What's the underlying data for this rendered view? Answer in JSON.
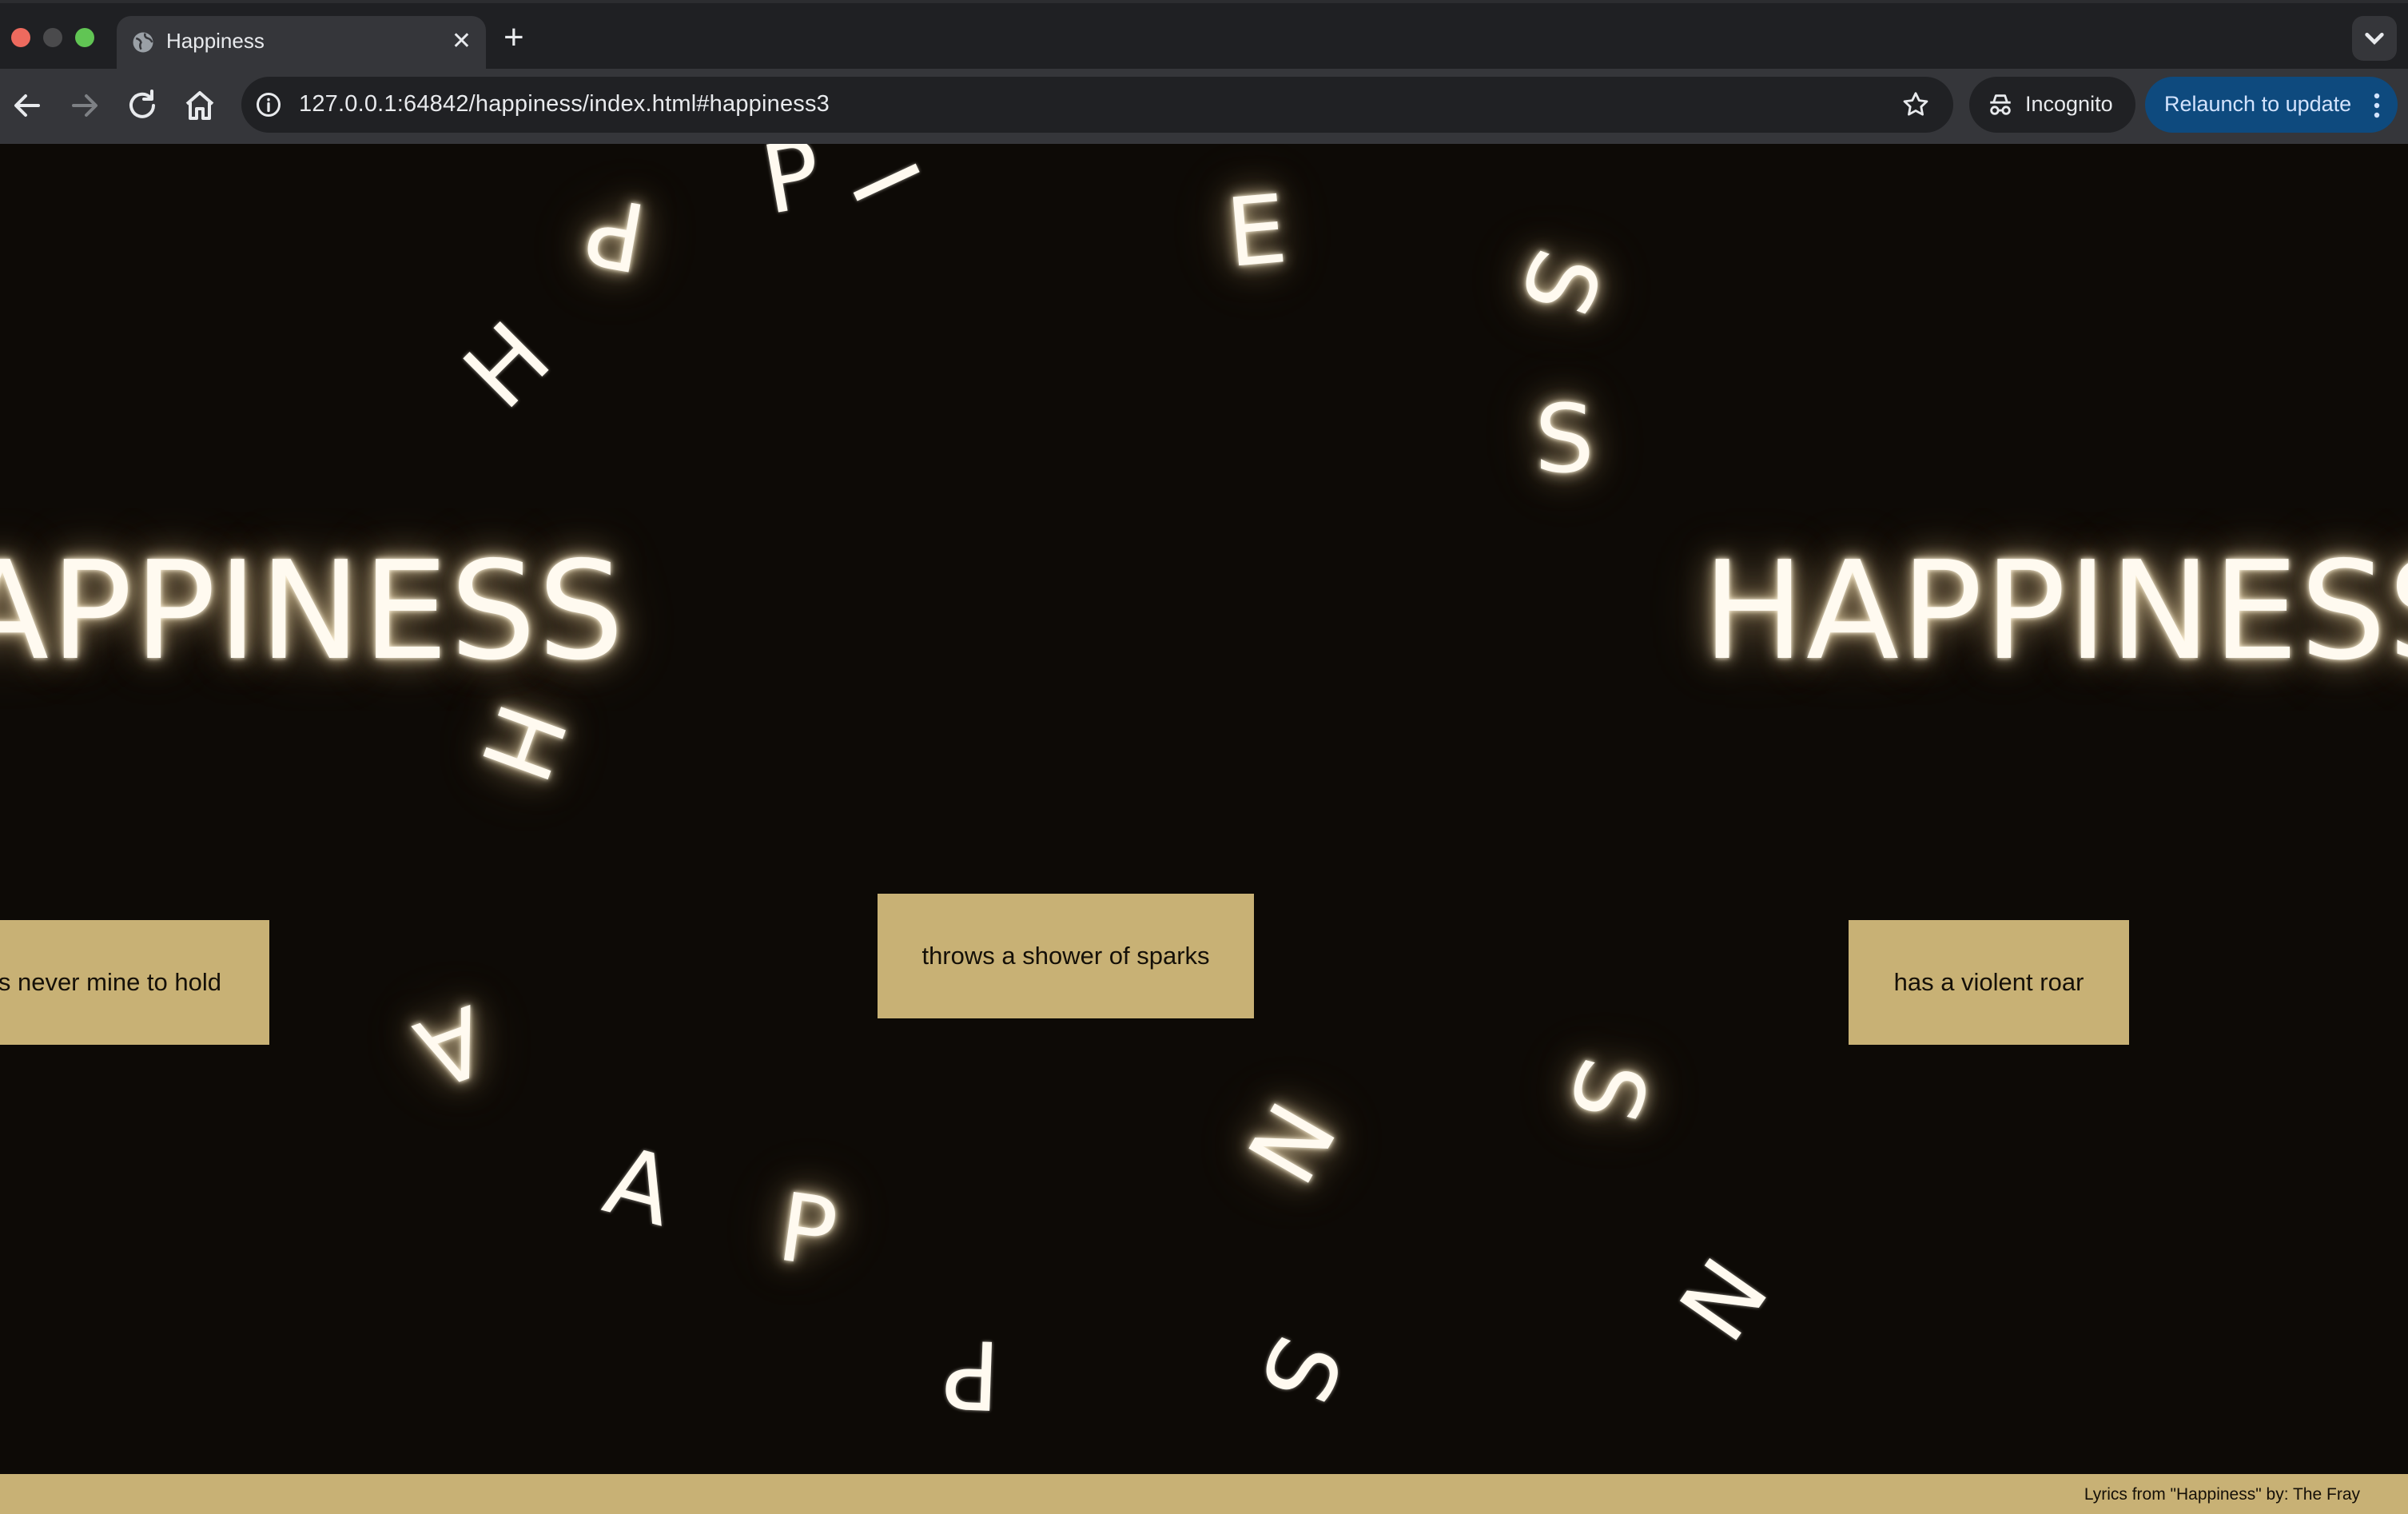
{
  "browser": {
    "tab_title": "Happiness",
    "tab_close": "✕",
    "new_tab": "+",
    "url": "127.0.0.1:64842/happiness/index.html#happiness3",
    "incognito_label": "Incognito",
    "relaunch_label": "Relaunch to update"
  },
  "page": {
    "words": [
      "HAPPINESS",
      "HAPPINESS"
    ],
    "letters": [
      "P",
      "P",
      "I",
      "E",
      "H",
      "S",
      "S",
      "H",
      "A",
      "A",
      "P",
      "N",
      "S",
      "P",
      "S",
      "N"
    ],
    "lyrics": [
      "was never mine to hold",
      "throws a shower of sparks",
      "has a violent roar"
    ],
    "footer": "Lyrics from \"Happiness\" by: The Fray"
  },
  "colors": {
    "background": "#0d0a06",
    "lyric_box": "#c8b175",
    "glow": "#fffaf0",
    "relaunch": "#0e4a7e"
  }
}
